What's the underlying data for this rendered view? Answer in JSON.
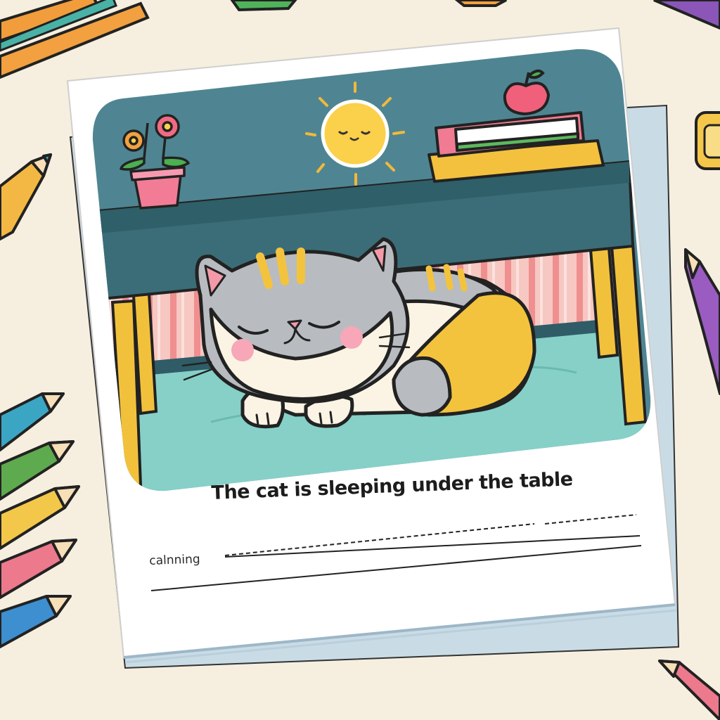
{
  "worksheet": {
    "caption": "The cat is sleeping under the table",
    "answer_label": "calnning"
  },
  "colors": {
    "background": "#f6efdf",
    "wall": "#4f8592",
    "floor": "#86d0c8",
    "table": "#3b6d78",
    "table_legs": "#f2c13c",
    "sun": "#fbd04a",
    "cat_gray": "#b8bcc0",
    "cat_orange": "#f4c33d"
  }
}
